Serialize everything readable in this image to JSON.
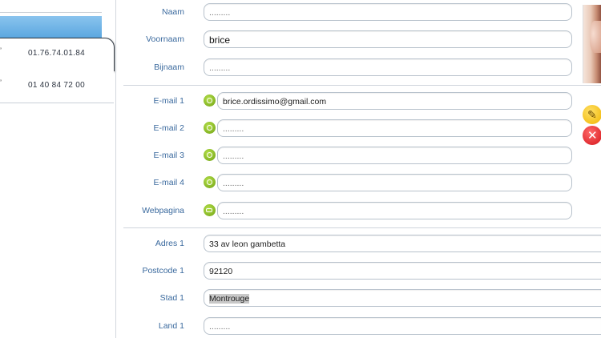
{
  "contacts": [
    {
      "mark": "’",
      "phone": "01.76.74.01.84",
      "selected": true
    },
    {
      "mark": "’",
      "phone": "01 40 84 72 00",
      "selected": false
    }
  ],
  "form": {
    "naam": {
      "label": "Naam",
      "value": "........."
    },
    "voornaam": {
      "label": "Voornaam",
      "value": "brice"
    },
    "bijnaam": {
      "label": "Bijnaam",
      "value": "........."
    },
    "email1": {
      "label": "E-mail 1",
      "value": "brice.ordissimo@gmail.com"
    },
    "email2": {
      "label": "E-mail 2",
      "value": "........."
    },
    "email3": {
      "label": "E-mail 3",
      "value": "........."
    },
    "email4": {
      "label": "E-mail 4",
      "value": "........."
    },
    "webpagina": {
      "label": "Webpagina",
      "value": "........."
    },
    "adres1": {
      "label": "Adres 1",
      "value": "33 av leon gambetta"
    },
    "postcode1": {
      "label": "Postcode 1",
      "value": "92120"
    },
    "stad1": {
      "label": "Stad 1",
      "value": "Montrouge"
    },
    "land1": {
      "label": "Land 1",
      "value": "........."
    }
  },
  "icons": {
    "email_status": "email-status-icon",
    "web_status": "web-status-icon",
    "edit": "pencil-icon",
    "delete": "close-icon"
  },
  "colors": {
    "accent_blue": "#5aa6df",
    "label_blue": "#3b6a9e",
    "status_green": "#8bc21c",
    "edit_yellow": "#f0b400",
    "delete_red": "#d4141a"
  }
}
